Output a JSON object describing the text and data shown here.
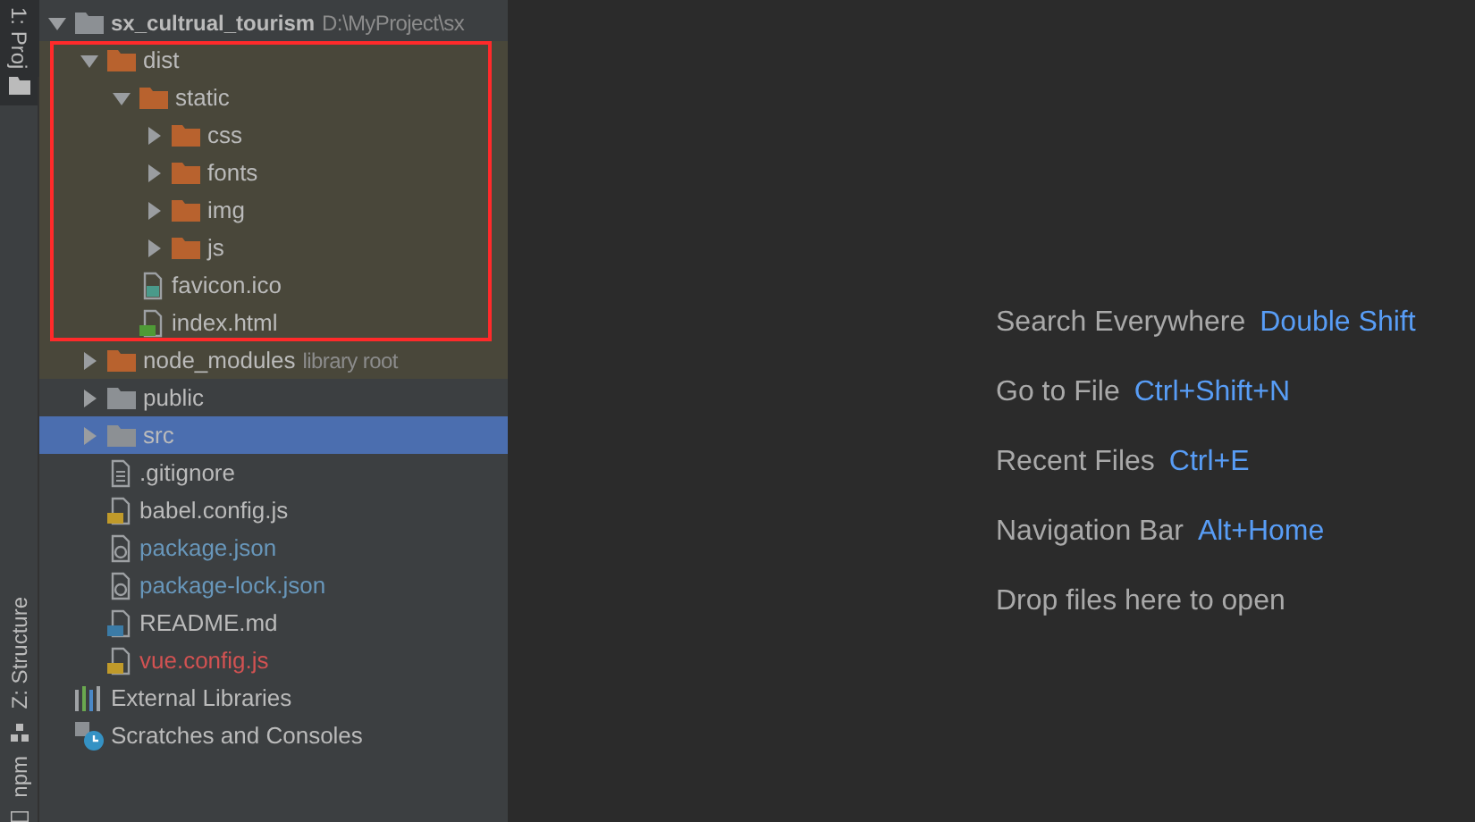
{
  "tool_strip": {
    "top_tabs": [
      {
        "label": "1: Proj",
        "selected": true
      }
    ],
    "bottom_tabs": [
      {
        "label": "Z: Structure",
        "selected": false
      },
      {
        "label": "npm",
        "selected": false
      }
    ]
  },
  "project_tree": {
    "items": [
      {
        "name": "sx_cultrual_tourism",
        "suffix": "D:\\MyProject\\sx",
        "kind": "folder",
        "expanded": true,
        "selected": false,
        "excluded": false,
        "color": "#bbbbbb",
        "children": [
          {
            "name": "dist",
            "kind": "folder",
            "expanded": true,
            "selected": false,
            "excluded": true,
            "annotated": true,
            "color": "#bbbbbb",
            "children": [
              {
                "name": "static",
                "kind": "folder",
                "expanded": true,
                "selected": false,
                "excluded": true,
                "color": "#bbbbbb",
                "children": [
                  {
                    "name": "css",
                    "kind": "folder",
                    "expanded": false,
                    "selected": false,
                    "excluded": true,
                    "color": "#bbbbbb"
                  },
                  {
                    "name": "fonts",
                    "kind": "folder",
                    "expanded": false,
                    "selected": false,
                    "excluded": true,
                    "color": "#bbbbbb"
                  },
                  {
                    "name": "img",
                    "kind": "folder",
                    "expanded": false,
                    "selected": false,
                    "excluded": true,
                    "color": "#bbbbbb"
                  },
                  {
                    "name": "js",
                    "kind": "folder",
                    "expanded": false,
                    "selected": false,
                    "excluded": true,
                    "color": "#bbbbbb"
                  }
                ]
              },
              {
                "name": "favicon.ico",
                "kind": "image",
                "selected": false,
                "excluded": true,
                "color": "#bbbbbb"
              },
              {
                "name": "index.html",
                "kind": "html",
                "selected": false,
                "excluded": true,
                "color": "#bbbbbb"
              }
            ]
          },
          {
            "name": "node_modules",
            "suffix": "library root",
            "kind": "folder",
            "expanded": false,
            "selected": false,
            "excluded": true,
            "color": "#bbbbbb"
          },
          {
            "name": "public",
            "kind": "folder",
            "expanded": false,
            "selected": false,
            "excluded": false,
            "color": "#bbbbbb"
          },
          {
            "name": "src",
            "kind": "folder",
            "expanded": false,
            "selected": true,
            "excluded": false,
            "color": "#bbbbbb"
          },
          {
            "name": ".gitignore",
            "kind": "text",
            "selected": false,
            "excluded": false,
            "color": "#bbbbbb"
          },
          {
            "name": "babel.config.js",
            "kind": "js",
            "selected": false,
            "excluded": false,
            "color": "#bbbbbb"
          },
          {
            "name": "package.json",
            "kind": "json",
            "selected": false,
            "excluded": false,
            "color": "#6897bb"
          },
          {
            "name": "package-lock.json",
            "kind": "json",
            "selected": false,
            "excluded": false,
            "color": "#6897bb"
          },
          {
            "name": "README.md",
            "kind": "md",
            "selected": false,
            "excluded": false,
            "color": "#bbbbbb"
          },
          {
            "name": "vue.config.js",
            "kind": "js",
            "selected": false,
            "excluded": false,
            "color": "#d25252"
          }
        ]
      },
      {
        "name": "External Libraries",
        "kind": "libraries",
        "selected": false,
        "excluded": false,
        "color": "#bbbbbb"
      },
      {
        "name": "Scratches and Consoles",
        "kind": "scratches",
        "selected": false,
        "excluded": false,
        "color": "#bbbbbb"
      }
    ]
  },
  "editor_hints": [
    {
      "label": "Search Everywhere",
      "shortcut": "Double Shift"
    },
    {
      "label": "Go to File",
      "shortcut": "Ctrl+Shift+N"
    },
    {
      "label": "Recent Files",
      "shortcut": "Ctrl+E"
    },
    {
      "label": "Navigation Bar",
      "shortcut": "Alt+Home"
    },
    {
      "label": "Drop files here to open"
    }
  ]
}
